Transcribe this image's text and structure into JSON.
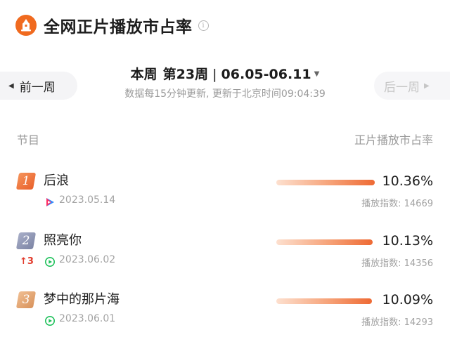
{
  "header": {
    "title": "全网正片播放市占率",
    "icon": "app-logo-icon",
    "info_icon": "info-icon",
    "info_glyph": "i"
  },
  "week_nav": {
    "prev_label": "前一周",
    "next_label": "后一周",
    "week_label": "本周",
    "week_number": "第23周",
    "separator": "|",
    "date_range": "06.05-06.11",
    "update_text": "数据每15分钟更新, 更新于北京时间09:04:39"
  },
  "columns": {
    "left": "节目",
    "right": "正片播放市占率"
  },
  "rows": [
    {
      "rank": "1",
      "name": "后浪",
      "date": "2023.05.14",
      "share": "10.36%",
      "share_value": 10.36,
      "index": "播放指数: 14669",
      "trend": "",
      "platform_icon": "tencent-video-icon"
    },
    {
      "rank": "2",
      "name": "照亮你",
      "date": "2023.06.02",
      "share": "10.13%",
      "share_value": 10.13,
      "index": "播放指数: 14356",
      "trend": "↑3",
      "platform_icon": "iqiyi-icon"
    },
    {
      "rank": "3",
      "name": "梦中的那片海",
      "date": "2023.06.01",
      "share": "10.09%",
      "share_value": 10.09,
      "index": "播放指数: 14293",
      "trend": "",
      "platform_icon": "iqiyi-icon"
    }
  ],
  "colors": {
    "accent": "#ee6a34",
    "rank1": "#e9602b",
    "rank2": "#7c84a4",
    "rank3": "#d8925b",
    "trend_up": "#e23b2c",
    "iqiyi": "#1fc15b"
  }
}
